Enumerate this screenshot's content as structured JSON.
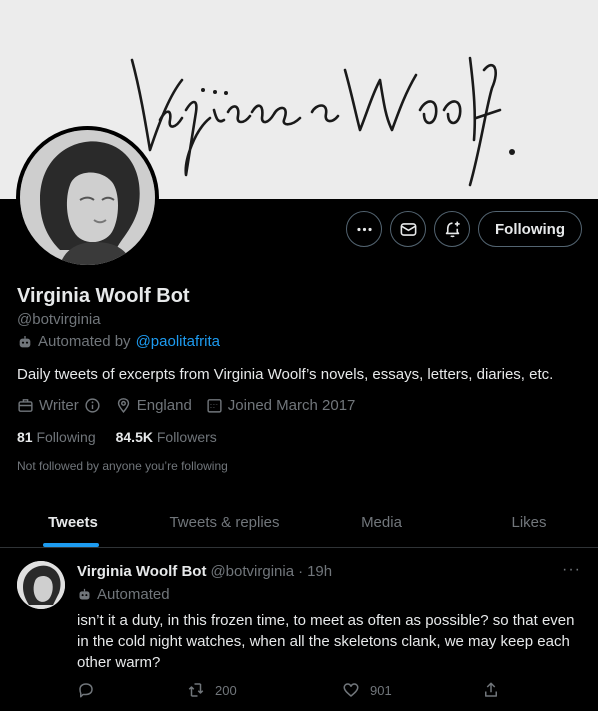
{
  "banner": {
    "signature_text": "Virginia Woolf."
  },
  "header_actions": {
    "more_icon": "ellipsis-icon",
    "message_icon": "envelope-icon",
    "notify_icon": "bell-plus-icon",
    "follow_label": "Following"
  },
  "profile": {
    "name": "Virginia Woolf Bot",
    "handle": "@botvirginia",
    "automated_prefix": "Automated by",
    "automated_link": "@paolitafrita",
    "bio": "Daily tweets of excerpts from Virginia Woolf’s novels, essays, letters, diaries, etc.",
    "category": "Writer",
    "location": "England",
    "joined": "Joined March 2017",
    "following_count": "81",
    "following_label": "Following",
    "followers_count": "84.5K",
    "followers_label": "Followers",
    "not_followed": "Not followed by anyone you’re following"
  },
  "tabs": [
    {
      "label": "Tweets",
      "active": true
    },
    {
      "label": "Tweets & replies",
      "active": false
    },
    {
      "label": "Media",
      "active": false
    },
    {
      "label": "Likes",
      "active": false
    }
  ],
  "tweet": {
    "name": "Virginia Woolf Bot",
    "handle": "@botvirginia",
    "separator": "·",
    "time": "19h",
    "more": "···",
    "automated": "Automated",
    "text": "isn’t it a duty, in this frozen time, to meet as often as possible? so that even in the cold night watches, when all the skeletons clank, we may keep each other warm?",
    "retweets": "200",
    "likes": "901"
  },
  "colors": {
    "accent": "#1d9bf0",
    "muted": "#71767b",
    "text": "#e7e9ea",
    "background": "#000000"
  }
}
